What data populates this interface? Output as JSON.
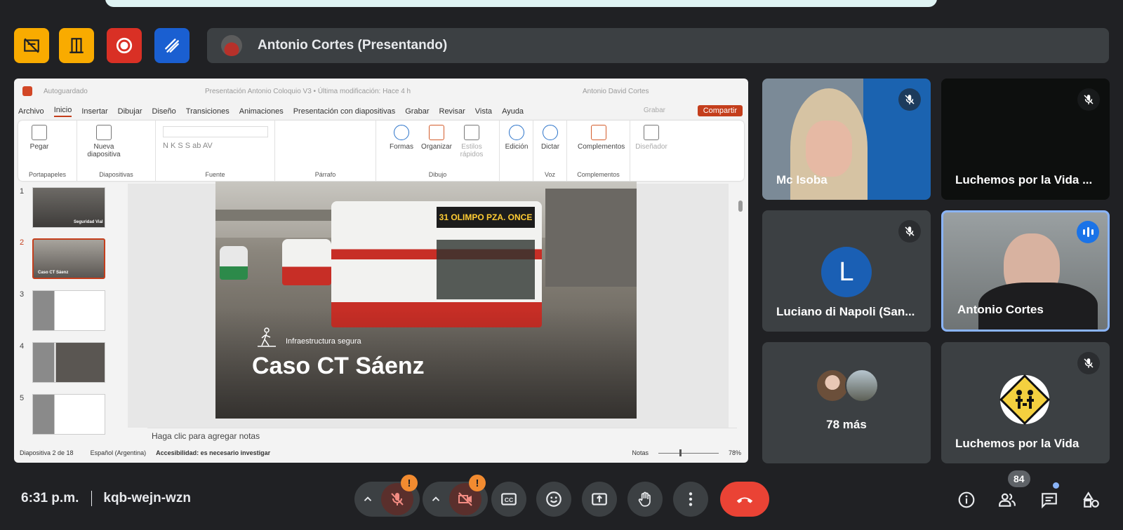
{
  "meeting": {
    "presenter_banner": "Antonio Cortes (Presentando)",
    "time": "6:31 p.m.",
    "code": "kqb-wejn-wzn",
    "participant_count": "84"
  },
  "top_actions": [
    {
      "name": "captions-off-icon",
      "color": "#f9ab00"
    },
    {
      "name": "breakout-door-icon",
      "color": "#f9ab00"
    },
    {
      "name": "record-icon",
      "color": "#d93025"
    },
    {
      "name": "whiteboard-icon",
      "color": "#1a73e8"
    }
  ],
  "ppt": {
    "autosave": "Autoguardado",
    "doc_title": "Presentación Antonio Coloquio V3 • Última modificación: Hace 4 h",
    "user": "Antonio David Cortes",
    "menu": [
      "Archivo",
      "Inicio",
      "Insertar",
      "Dibujar",
      "Diseño",
      "Transiciones",
      "Animaciones",
      "Presentación con diapositivas",
      "Grabar",
      "Revisar",
      "Vista",
      "Ayuda"
    ],
    "record_label": "Grabar",
    "share_label": "Compartir",
    "groups": {
      "clipboard": "Portapapeles",
      "slides": "Diapositivas",
      "font": "Fuente",
      "paragraph": "Párrafo",
      "drawing": "Dibujo",
      "voice": "Voz",
      "addins": "Complementos"
    },
    "tools": {
      "paste": "Pegar",
      "new_slide": "Nueva diapositiva",
      "shapes": "Formas",
      "arrange": "Organizar",
      "quick_styles": "Estilos rápidos",
      "edit": "Edición",
      "dictate": "Dictar",
      "addins": "Complementos",
      "designer": "Diseñador"
    },
    "thumbnails": [
      {
        "num": "1",
        "caption": "Seguridad Vial"
      },
      {
        "num": "2",
        "caption": "Caso CT Sáenz"
      },
      {
        "num": "3",
        "caption": ""
      },
      {
        "num": "4",
        "caption": ""
      },
      {
        "num": "5",
        "caption": ""
      }
    ],
    "slide": {
      "bus_sign": "31 OLIMPO PZA. ONCE",
      "subtitle": "Infraestructura segura",
      "title": "Caso CT Sáenz"
    },
    "notes_placeholder": "Haga clic para agregar notas",
    "status": {
      "slide_pos": "Diapositiva 2 de 18",
      "language": "Español (Argentina)",
      "accessibility": "Accesibilidad: es necesario investigar",
      "notes": "Notas",
      "zoom": "78%"
    }
  },
  "tiles": [
    {
      "name": "Mc Isoba",
      "muted": true
    },
    {
      "name": "Luchemos por la Vida ...",
      "muted": true
    },
    {
      "name": "Luciano di Napoli (San...",
      "initial": "L",
      "muted": true
    },
    {
      "name": "Antonio Cortes",
      "speaking": true
    },
    {
      "more_label": "78 más"
    },
    {
      "name": "Luchemos por la Vida",
      "muted": true
    }
  ]
}
